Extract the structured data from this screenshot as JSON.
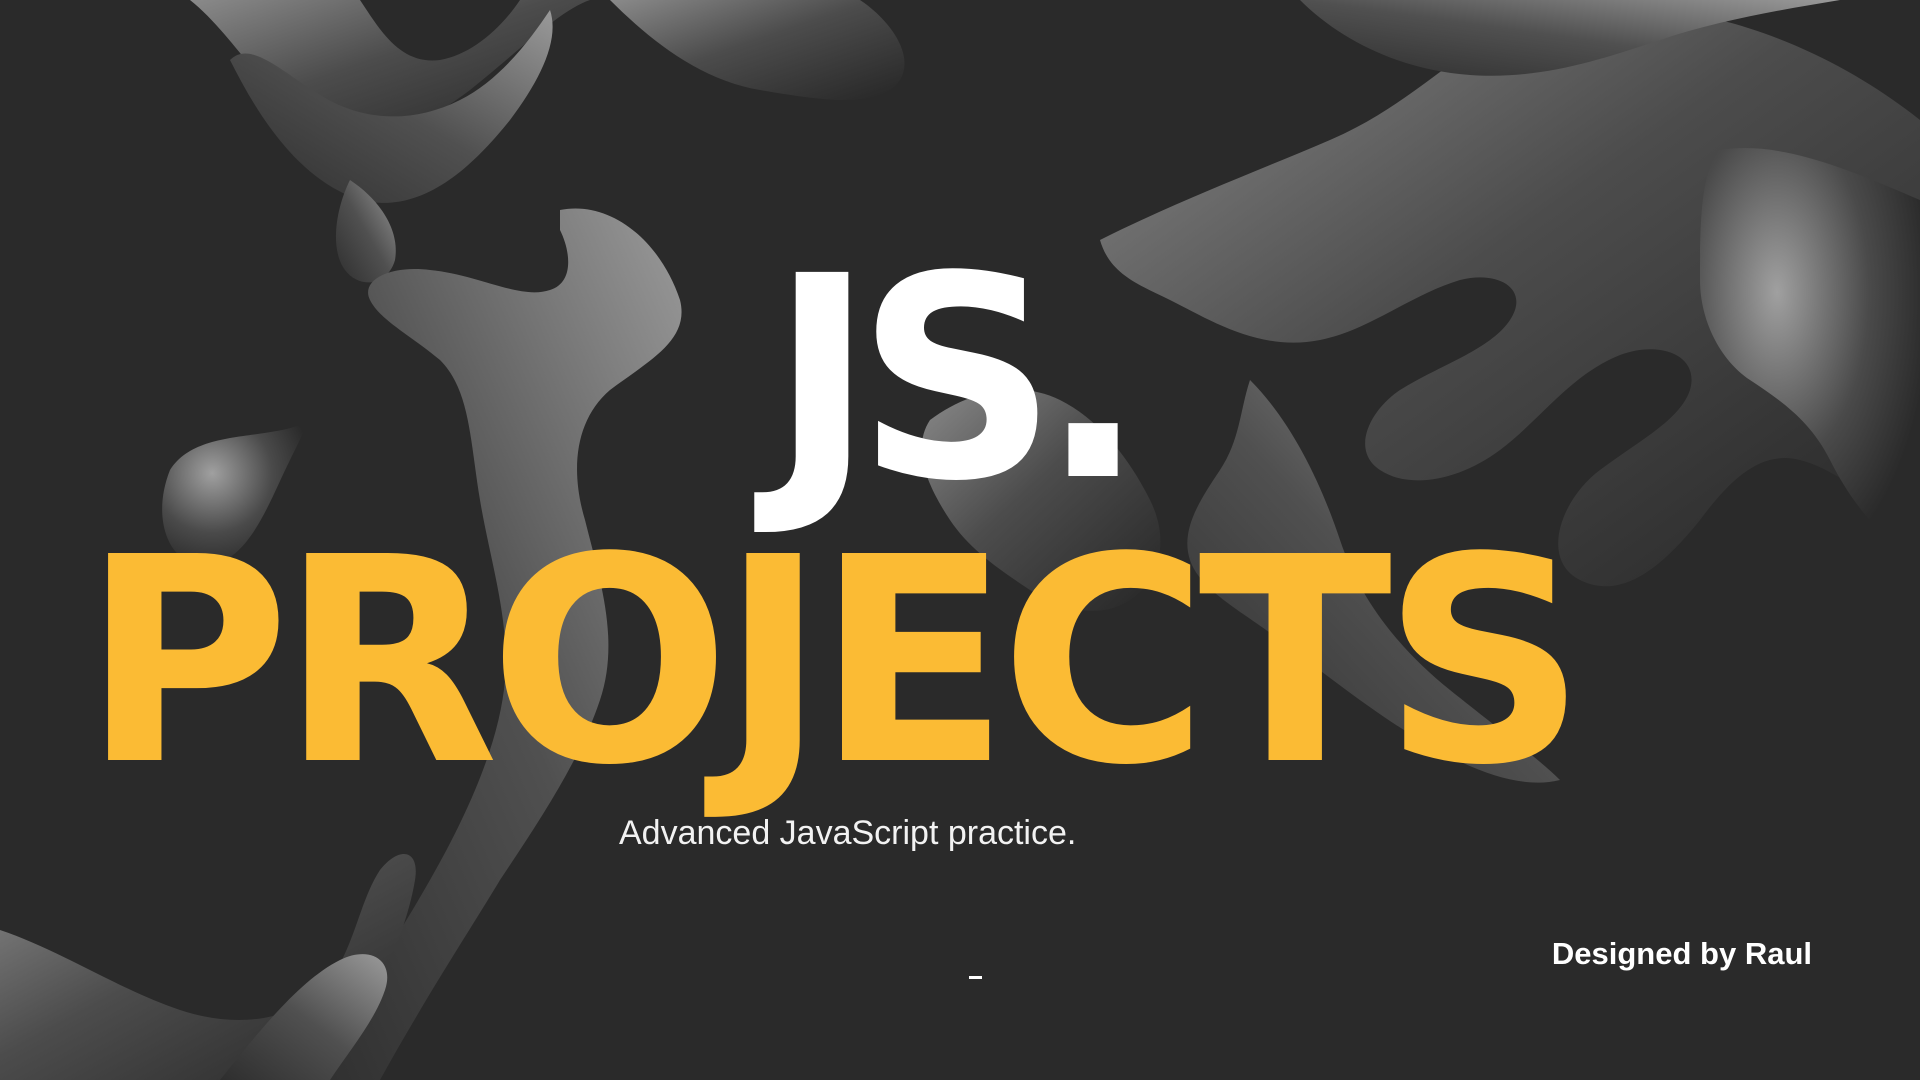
{
  "hero": {
    "line1": "JS.",
    "line2": "PROJECTS",
    "tagline": "Advanced JavaScript practice.",
    "credit": "Designed by Raul"
  },
  "decor": {
    "background": "abstract-liquid-metal-blobs",
    "dash_icon": "dash-indicator-icon"
  },
  "colors": {
    "background": "#2a2a2a",
    "accent": "#fbbb34",
    "text": "#ffffff",
    "blob_dark": "#3a3a3a",
    "blob_light": "#7a7a7a"
  }
}
